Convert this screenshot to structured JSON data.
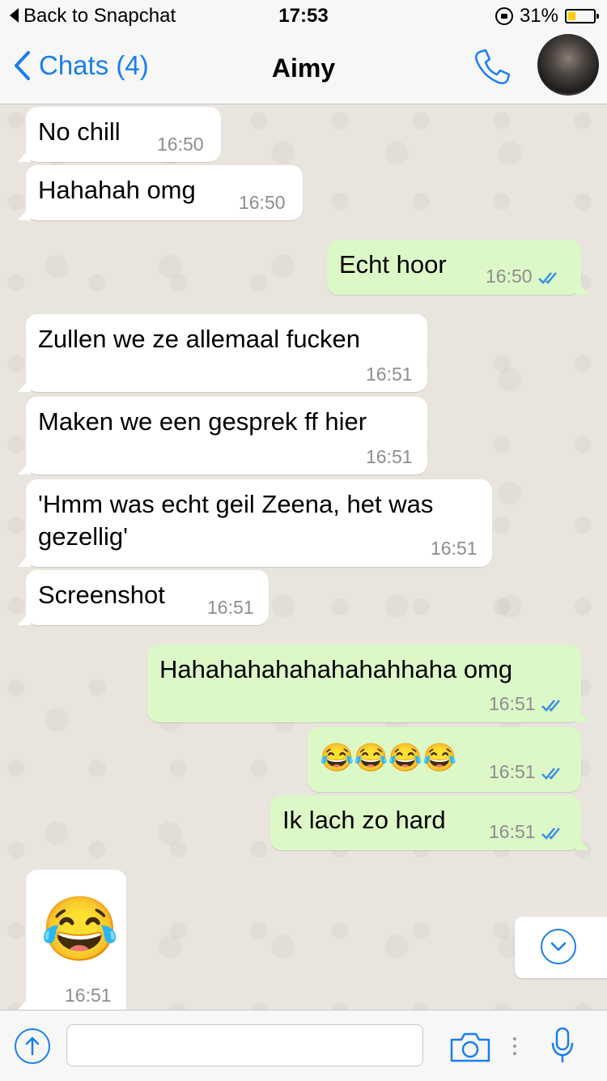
{
  "status_bar": {
    "back_label": "Back to Snapchat",
    "time": "17:53",
    "battery_text": "31%",
    "battery_level": 0.31
  },
  "nav": {
    "back_label": "Chats (4)",
    "title": "Aimy"
  },
  "messages": [
    {
      "dir": "in",
      "text": "No chill",
      "time": "16:50"
    },
    {
      "dir": "in",
      "text": "Hahahah omg",
      "time": "16:50"
    },
    {
      "dir": "out",
      "text": "Echt hoor",
      "time": "16:50"
    },
    {
      "dir": "in",
      "text": "Zullen we ze allemaal fucken",
      "time": "16:51"
    },
    {
      "dir": "in",
      "text": "Maken we een gesprek ff hier",
      "time": "16:51"
    },
    {
      "dir": "in",
      "text": "'Hmm was echt geil Zeena, het was",
      "text2": "gezellig'",
      "time": "16:51"
    },
    {
      "dir": "in",
      "text": "Screenshot",
      "time": "16:51"
    },
    {
      "dir": "out",
      "text": "Hahahahahahahahahhaha omg",
      "time": "16:51"
    },
    {
      "dir": "out",
      "text": "😂😂😂😂",
      "time": "16:51"
    },
    {
      "dir": "out",
      "text": "Ik lach zo hard",
      "time": "16:51"
    },
    {
      "dir": "in",
      "text": "😂",
      "time": "16:51"
    }
  ],
  "colors": {
    "accent": "#1a7ef0",
    "incoming": "#ffffff",
    "outgoing": "#dcf8c6",
    "read_ticks": "#3b8fe0"
  },
  "icons": [
    "chevron-left-icon",
    "phone-icon",
    "chevron-down-icon",
    "arrow-up-icon",
    "camera-icon",
    "microphone-icon",
    "double-check-icon"
  ]
}
